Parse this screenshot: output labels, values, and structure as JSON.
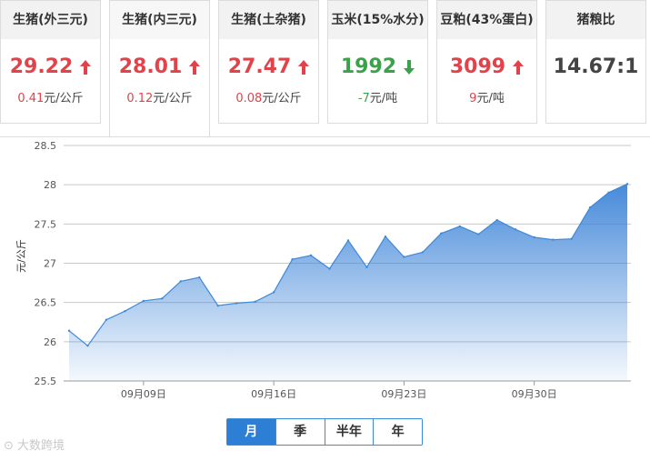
{
  "cards": [
    {
      "title": "生猪(外三元)",
      "price": "29.22",
      "change": "0.41元/公斤",
      "trend": "up",
      "color": "#e2434a"
    },
    {
      "title": "生猪(内三元)",
      "price": "28.01",
      "change": "0.12元/公斤",
      "trend": "up",
      "color": "#e2434a",
      "active": true
    },
    {
      "title": "生猪(土杂猪)",
      "price": "27.47",
      "change": "0.08元/公斤",
      "trend": "up",
      "color": "#e2434a"
    },
    {
      "title": "玉米(15%水分)",
      "price": "1992",
      "change": "-7元/吨",
      "trend": "down",
      "color": "#3aa34a"
    },
    {
      "title": "豆粕(43%蛋白)",
      "price": "3099",
      "change": "9元/吨",
      "trend": "up",
      "color": "#e2434a"
    },
    {
      "title": "猪粮比",
      "price": "14.67:1",
      "change": "",
      "trend": "none",
      "color": "#444444"
    }
  ],
  "chart_data": {
    "type": "area",
    "ylabel": "元/公斤",
    "ylim": [
      25.5,
      28.5
    ],
    "yticks": [
      25.5,
      26,
      26.5,
      27,
      27.5,
      28,
      28.5
    ],
    "xticks": [
      "09月09日",
      "09月16日",
      "09月23日",
      "09月30日"
    ],
    "grid": true,
    "x": [
      "09月05日",
      "09月06日",
      "09月07日",
      "09月08日",
      "09月09日",
      "09月10日",
      "09月11日",
      "09月12日",
      "09月13日",
      "09月14日",
      "09月15日",
      "09月16日",
      "09月17日",
      "09月18日",
      "09月19日",
      "09月20日",
      "09月21日",
      "09月22日",
      "09月23日",
      "09月24日",
      "09月25日",
      "09月26日",
      "09月27日",
      "09月28日",
      "09月29日",
      "09月30日",
      "10月01日",
      "10月02日",
      "10月03日",
      "10月04日",
      "10月05日"
    ],
    "values": [
      26.14,
      25.95,
      26.28,
      26.39,
      26.52,
      26.55,
      26.77,
      26.82,
      26.46,
      26.49,
      26.51,
      26.63,
      27.05,
      27.1,
      26.93,
      27.29,
      26.95,
      27.34,
      27.08,
      27.14,
      27.38,
      27.47,
      27.37,
      27.55,
      27.43,
      27.33,
      27.3,
      27.31,
      27.71,
      27.9,
      28.01
    ],
    "line_color": "#3d8ad8"
  },
  "tabs": [
    "月",
    "季",
    "半年",
    "年"
  ],
  "active_tab": "月",
  "watermark": "大数跨境"
}
